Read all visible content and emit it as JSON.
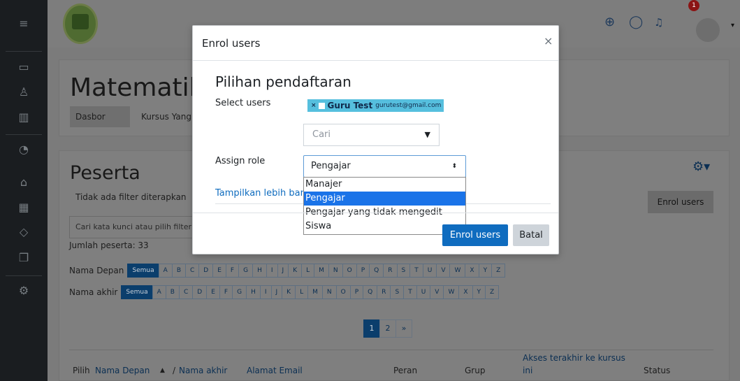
{
  "sidebar": {
    "icons": [
      "hamburger-icon",
      "folder-icon",
      "user-group-icon",
      "book-icon",
      "gauge-icon",
      "home-icon",
      "calendar-icon",
      "graduation-cap-icon",
      "file-copy-icon",
      "gear-icon"
    ]
  },
  "navbar": {
    "notification_count": "1"
  },
  "page": {
    "course_title": "Matematika",
    "breadcrumb": [
      "Dasbor",
      "Kursus Yang Saya Ikuti"
    ],
    "section_title": "Peserta",
    "filter_text": "Tidak ada filter diterapkan",
    "search_placeholder": "Cari kata kunci atau pilih filter",
    "participant_count": "Jumlah peserta: 33",
    "enrol_button": "Enrol users",
    "first_name_label": "Nama Depan",
    "last_name_label": "Nama akhir",
    "all_label": "Semua",
    "letters": [
      "A",
      "B",
      "C",
      "D",
      "E",
      "F",
      "G",
      "H",
      "I",
      "J",
      "K",
      "L",
      "M",
      "N",
      "O",
      "P",
      "Q",
      "R",
      "S",
      "T",
      "U",
      "V",
      "W",
      "X",
      "Y",
      "Z"
    ],
    "pages": [
      "1",
      "2",
      "»"
    ],
    "columns": {
      "select": "Pilih",
      "first_name": "Nama Depan",
      "sep": "/",
      "last_name": "Nama akhir",
      "email": "Alamat Email",
      "role": "Peran",
      "group": "Grup",
      "last_access_1": "Akses terakhir ke kursus",
      "last_access_2": "ini",
      "status": "Status"
    }
  },
  "modal": {
    "title": "Enrol users",
    "heading": "Pilihan pendaftaran",
    "select_users_label": "Select users",
    "selected_user_name": "Guru Test",
    "selected_user_email": "gurutest@gmail.com",
    "search_placeholder": "Cari",
    "assign_role_label": "Assign role",
    "role_value": "Pengajar",
    "role_options": [
      "Manajer",
      "Pengajar",
      "Pengajar yang tidak mengedit",
      "Siswa"
    ],
    "role_selected_index": 1,
    "show_more": "Tampilkan lebih banyak...",
    "primary_button": "Enrol users",
    "cancel_button": "Batal"
  }
}
